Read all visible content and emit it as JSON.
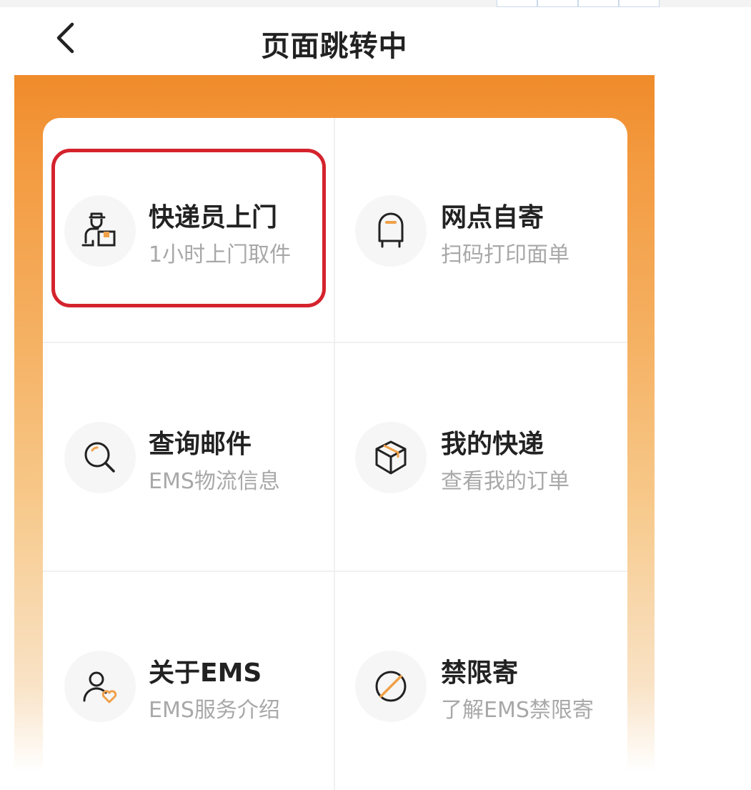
{
  "header": {
    "title": "页面跳转中"
  },
  "grid": {
    "items": [
      {
        "title": "快递员上门",
        "subtitle": "1小时上门取件",
        "icon": "courier-icon"
      },
      {
        "title": "网点自寄",
        "subtitle": "扫码打印面单",
        "icon": "mailbox-icon"
      },
      {
        "title": "查询邮件",
        "subtitle": "EMS物流信息",
        "icon": "search-icon"
      },
      {
        "title": "我的快递",
        "subtitle": "查看我的订单",
        "icon": "package-icon"
      },
      {
        "title": "关于EMS",
        "subtitle": "EMS服务介绍",
        "icon": "user-heart-icon"
      },
      {
        "title": "禁限寄",
        "subtitle": "了解EMS禁限寄",
        "icon": "prohibited-icon"
      }
    ]
  },
  "colors": {
    "accent": "#ef8b2a",
    "highlight": "#d4232d"
  }
}
